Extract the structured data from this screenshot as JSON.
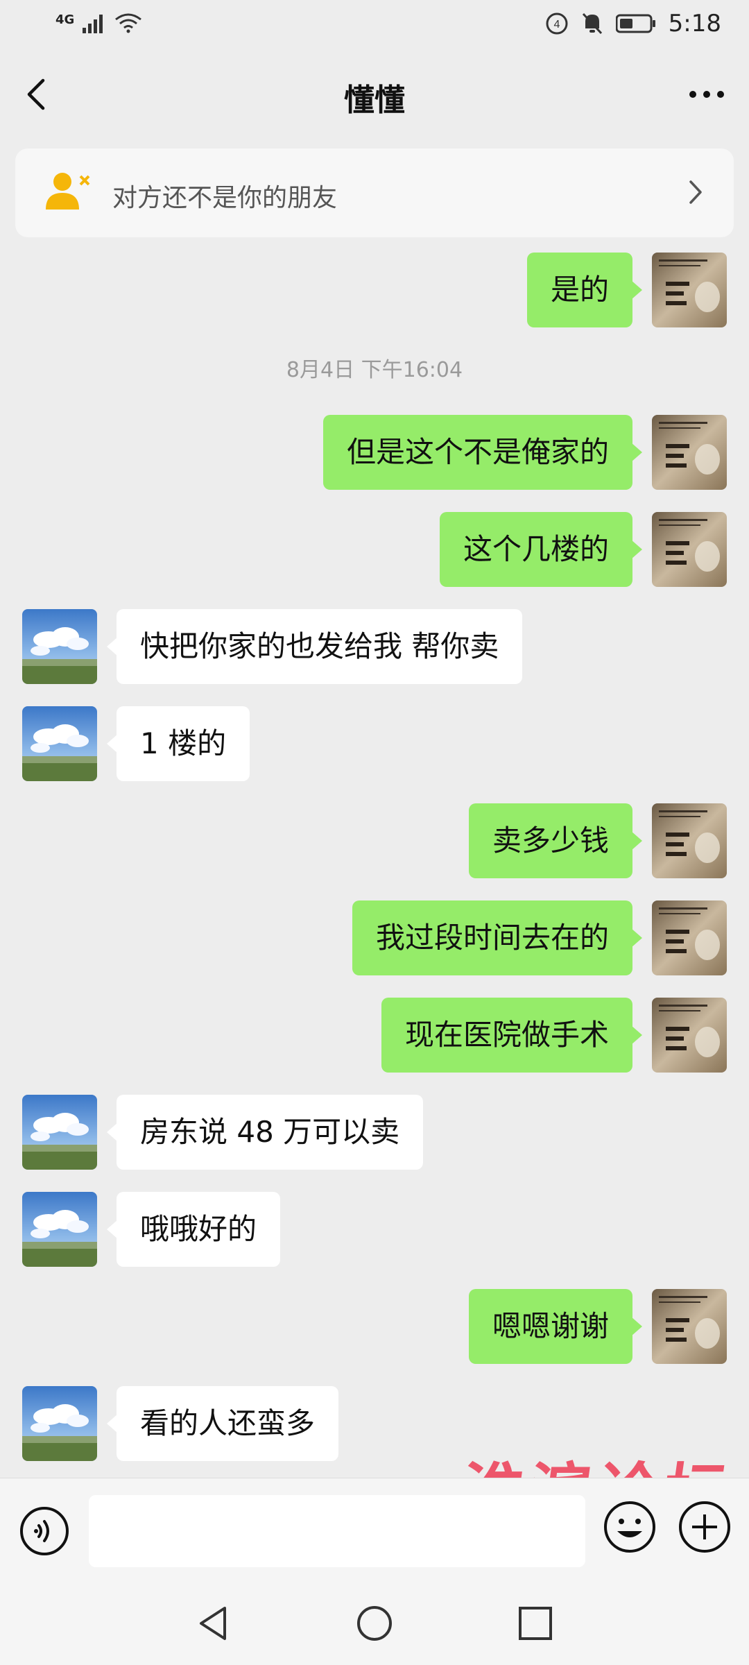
{
  "status_bar": {
    "network_label": "4G",
    "time": "5:18"
  },
  "header": {
    "title": "懂懂"
  },
  "banner": {
    "text": "对方还不是你的朋友"
  },
  "chat": {
    "timestamp": "8月4日 下午16:04",
    "messages": [
      {
        "from": "me",
        "text": "是的"
      },
      {
        "from": "me",
        "text": "但是这个不是俺家的"
      },
      {
        "from": "me",
        "text": "这个几楼的"
      },
      {
        "from": "other",
        "text": "快把你家的也发给我  帮你卖"
      },
      {
        "from": "other",
        "text": "1 楼的"
      },
      {
        "from": "me",
        "text": "卖多少钱"
      },
      {
        "from": "me",
        "text": "我过段时间去在的"
      },
      {
        "from": "me",
        "text": "现在医院做手术"
      },
      {
        "from": "other",
        "text": "房东说 48 万可以卖"
      },
      {
        "from": "other",
        "text": "哦哦好的"
      },
      {
        "from": "me",
        "text": "嗯嗯谢谢"
      },
      {
        "from": "other",
        "text": "看的人还蛮多"
      }
    ]
  },
  "input": {
    "value": "",
    "placeholder": ""
  },
  "watermark": "淮滨论坛",
  "colors": {
    "background": "#ededed",
    "my_bubble": "#95ec69",
    "other_bubble": "#ffffff",
    "banner_icon": "#f5b60a",
    "watermark": "#ee4a60"
  },
  "icons": {
    "back": "chevron-left-icon",
    "more": "more-horizontal-icon",
    "banner": "user-remove-icon",
    "voice": "voice-icon",
    "emoji": "emoji-icon",
    "plus": "plus-icon"
  }
}
